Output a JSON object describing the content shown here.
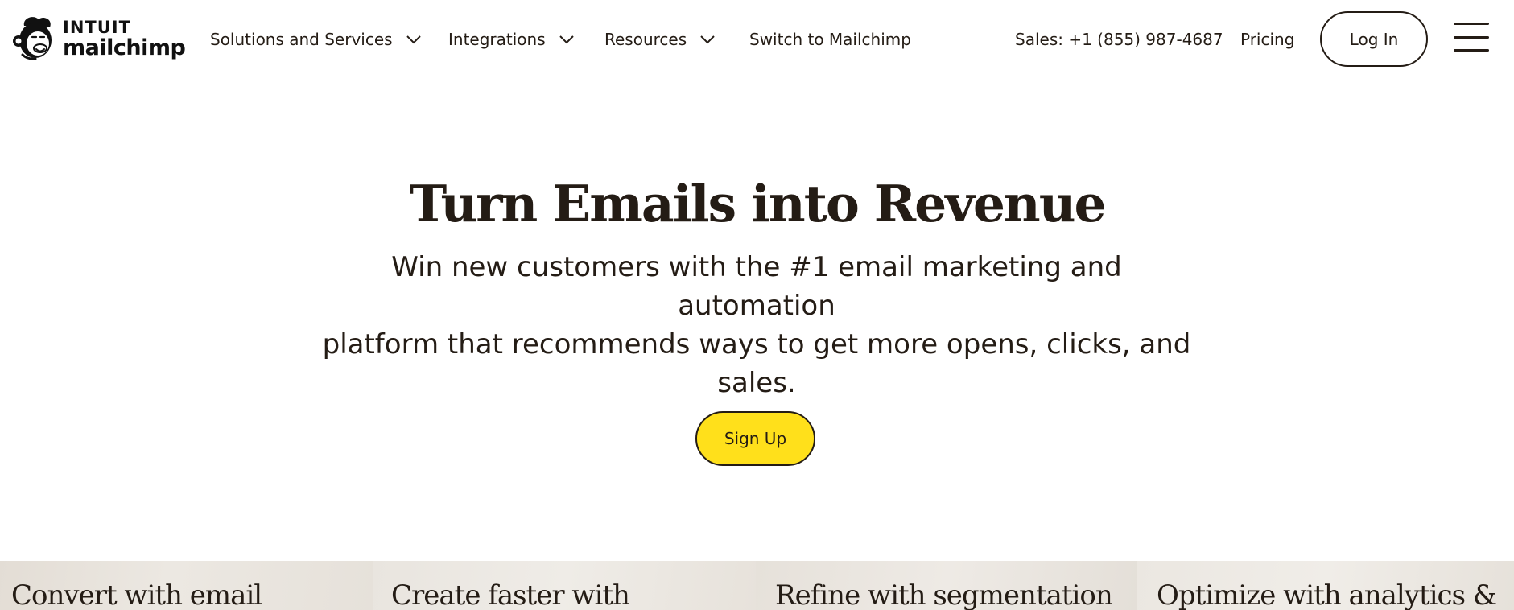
{
  "brand": {
    "parent": "INTUIT",
    "name": "mailchimp",
    "icon": "freddie-chimp-logo-icon"
  },
  "nav": {
    "items": [
      {
        "label": "Solutions and Services",
        "has_dropdown": true
      },
      {
        "label": "Integrations",
        "has_dropdown": true
      },
      {
        "label": "Resources",
        "has_dropdown": true
      },
      {
        "label": "Switch to Mailchimp",
        "has_dropdown": false
      }
    ],
    "sales": "Sales: +1 (855) 987-4687",
    "pricing": "Pricing",
    "login": "Log In",
    "menu_icon": "hamburger-menu-icon"
  },
  "hero": {
    "title": "Turn Emails into Revenue",
    "subtitle_lines": [
      "Win new customers with the #1 email marketing and automation",
      "platform that recommends ways to get more opens, clicks, and",
      "sales."
    ],
    "cta": "Sign Up"
  },
  "cards": [
    {
      "title": "Convert with email"
    },
    {
      "title": "Create faster with"
    },
    {
      "title": "Refine with segmentation"
    },
    {
      "title": "Optimize with analytics &"
    }
  ],
  "colors": {
    "text": "#241c15",
    "cta": "#ffe01b",
    "card_bg": "#e9e5df"
  }
}
